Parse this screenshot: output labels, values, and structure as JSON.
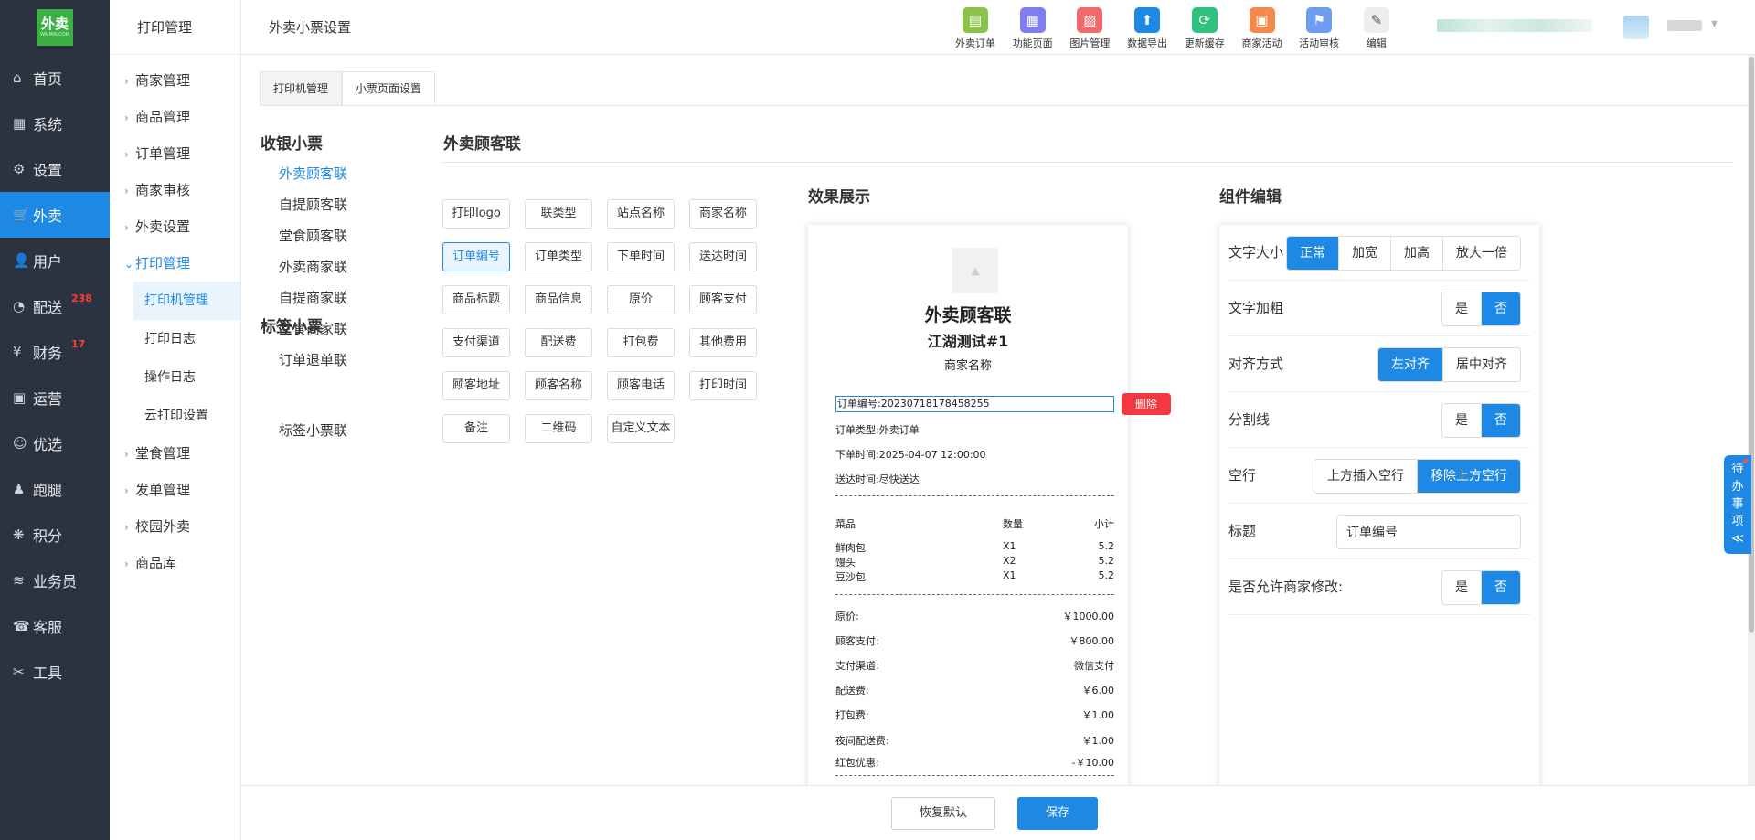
{
  "logo": {
    "text": "外卖",
    "sub": "WAIMAI.COM"
  },
  "sidebar": {
    "items": [
      {
        "label": "首页",
        "icon": "home-icon",
        "glyph": "⌂"
      },
      {
        "label": "系统",
        "icon": "windows-icon",
        "glyph": "▦"
      },
      {
        "label": "设置",
        "icon": "gear-icon",
        "glyph": "⚙"
      },
      {
        "label": "外卖",
        "icon": "cart-icon",
        "glyph": "🛒"
      },
      {
        "label": "用户",
        "icon": "user-icon",
        "glyph": "👤"
      },
      {
        "label": "配送",
        "icon": "dashboard-icon",
        "glyph": "◔",
        "badge": "238"
      },
      {
        "label": "财务",
        "icon": "yen-icon",
        "glyph": "¥",
        "badge": "17"
      },
      {
        "label": "运营",
        "icon": "gift-icon",
        "glyph": "▣"
      },
      {
        "label": "优选",
        "icon": "smile-icon",
        "glyph": "☺"
      },
      {
        "label": "跑腿",
        "icon": "person-icon",
        "glyph": "♟"
      },
      {
        "label": "积分",
        "icon": "points-icon",
        "glyph": "❋"
      },
      {
        "label": "业务员",
        "icon": "layers-icon",
        "glyph": "≋"
      },
      {
        "label": "客服",
        "icon": "headset-icon",
        "glyph": "☎"
      },
      {
        "label": "工具",
        "icon": "tools-icon",
        "glyph": "✂"
      }
    ]
  },
  "subnav": {
    "title": "打印管理",
    "items": [
      {
        "label": "商家管理"
      },
      {
        "label": "商品管理"
      },
      {
        "label": "订单管理"
      },
      {
        "label": "商家审核"
      },
      {
        "label": "外卖设置"
      },
      {
        "label": "打印管理"
      }
    ],
    "print_children": [
      {
        "label": "打印机管理"
      },
      {
        "label": "打印日志"
      },
      {
        "label": "操作日志"
      },
      {
        "label": "云打印设置"
      }
    ],
    "tail_items": [
      {
        "label": "堂食管理"
      },
      {
        "label": "发单管理"
      },
      {
        "label": "校园外卖"
      },
      {
        "label": "商品库"
      }
    ]
  },
  "header": {
    "title": "外卖小票设置",
    "tools": [
      {
        "label": "外卖订单",
        "icon": "order-icon",
        "color": "#8bc34a",
        "glyph": "▤"
      },
      {
        "label": "功能页面",
        "icon": "grid-icon",
        "color": "#7e7ef0",
        "glyph": "▦"
      },
      {
        "label": "图片管理",
        "icon": "image-icon",
        "color": "#f06a6a",
        "glyph": "▨"
      },
      {
        "label": "数据导出",
        "icon": "export-icon",
        "color": "#1e88e5",
        "glyph": "⬆"
      },
      {
        "label": "更新缓存",
        "icon": "refresh-icon",
        "color": "#2ec27e",
        "glyph": "⟳"
      },
      {
        "label": "商家活动",
        "icon": "gift-icon",
        "color": "#f5894a",
        "glyph": "▣"
      },
      {
        "label": "活动审核",
        "icon": "audit-icon",
        "color": "#6d9cf0",
        "glyph": "⚑"
      },
      {
        "label": "编辑",
        "icon": "edit-icon",
        "color": "#eeeeee",
        "glyph": "✎"
      }
    ]
  },
  "tabs": [
    {
      "label": "打印机管理"
    },
    {
      "label": "小票页面设置"
    }
  ],
  "categories": {
    "cashier_title": "收银小票",
    "cashier_items": [
      {
        "label": "外卖顾客联"
      },
      {
        "label": "自提顾客联"
      },
      {
        "label": "堂食顾客联"
      },
      {
        "label": "外卖商家联"
      },
      {
        "label": "自提商家联"
      },
      {
        "label": "堂食商家联"
      },
      {
        "label": "订单退单联"
      }
    ],
    "label_title": "标签小票",
    "label_items": [
      {
        "label": "标签小票联"
      }
    ]
  },
  "section": {
    "title": "外卖顾客联",
    "preview_title": "效果展示",
    "editor_title": "组件编辑"
  },
  "fields": [
    {
      "label": "打印logo"
    },
    {
      "label": "联类型"
    },
    {
      "label": "站点名称"
    },
    {
      "label": "商家名称"
    },
    {
      "label": "订单编号"
    },
    {
      "label": "订单类型"
    },
    {
      "label": "下单时间"
    },
    {
      "label": "送达时间"
    },
    {
      "label": "商品标题"
    },
    {
      "label": "商品信息"
    },
    {
      "label": "原价"
    },
    {
      "label": "顾客支付"
    },
    {
      "label": "支付渠道"
    },
    {
      "label": "配送费"
    },
    {
      "label": "打包费"
    },
    {
      "label": "其他费用"
    },
    {
      "label": "顾客地址"
    },
    {
      "label": "顾客名称"
    },
    {
      "label": "顾客电话"
    },
    {
      "label": "打印时间"
    },
    {
      "label": "备注"
    },
    {
      "label": "二维码"
    },
    {
      "label": "自定义文本"
    }
  ],
  "receipt": {
    "heading": "外卖顾客联",
    "store": "江湖测试#1",
    "merchant": "商家名称",
    "order_no": "订单编号:20230718178458255",
    "delete_label": "删除",
    "order_type": "订单类型:外卖订单",
    "order_time": "下单时间:2025-04-07 12:00:00",
    "delivery_time": "送达时间:尽快送达",
    "col_dish": "菜品",
    "col_qty": "数量",
    "col_subtotal": "小计",
    "items": [
      {
        "name": "鲜肉包",
        "qty": "X1",
        "subtotal": "5.2"
      },
      {
        "name": "馒头",
        "qty": "X2",
        "subtotal": "5.2"
      },
      {
        "name": "豆沙包",
        "qty": "X1",
        "subtotal": "5.2"
      }
    ],
    "totals": [
      {
        "label": "原价:",
        "value": "￥1000.00"
      },
      {
        "label": "顾客支付:",
        "value": "￥800.00"
      },
      {
        "label": "支付渠道:",
        "value": "微信支付"
      },
      {
        "label": "配送费:",
        "value": "￥6.00"
      },
      {
        "label": "打包费:",
        "value": "￥1.00"
      },
      {
        "label": "夜间配送费:",
        "value": "￥1.00"
      },
      {
        "label": "红包优惠:",
        "value": "-￥10.00"
      }
    ]
  },
  "editor": {
    "font_size": {
      "label": "文字大小",
      "options": [
        "正常",
        "加宽",
        "加高",
        "放大一倍"
      ],
      "selected": "正常"
    },
    "bold": {
      "label": "文字加粗",
      "options": [
        "是",
        "否"
      ],
      "selected": "否"
    },
    "align": {
      "label": "对齐方式",
      "options": [
        "左对齐",
        "居中对齐"
      ],
      "selected": "左对齐"
    },
    "divider": {
      "label": "分割线",
      "options": [
        "是",
        "否"
      ],
      "selected": "否"
    },
    "blank_line": {
      "label": "空行",
      "options": [
        "上方插入空行",
        "移除上方空行"
      ],
      "selected": "移除上方空行"
    },
    "title": {
      "label": "标题",
      "value": "订单编号"
    },
    "merchant_edit": {
      "label": "是否允许商家修改:",
      "options": [
        "是",
        "否"
      ],
      "selected": "否"
    }
  },
  "footer": {
    "reset_label": "恢复默认",
    "save_label": "保存"
  },
  "float_tab": {
    "label": "待办事项",
    "arrow": "≪"
  }
}
